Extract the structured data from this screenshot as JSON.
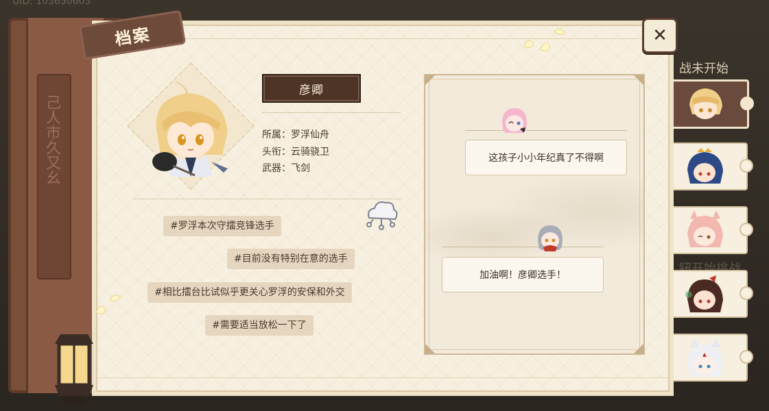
{
  "header": {
    "uid_label": "UID: 103650605"
  },
  "tag": {
    "label": "档案"
  },
  "close": {
    "symbol": "✕"
  },
  "profile": {
    "name": "彦卿",
    "affiliation_label": "所属：",
    "affiliation": "罗浮仙舟",
    "title_label": "头衔：",
    "title": "云骑骁卫",
    "weapon_label": "武器：",
    "weapon": "飞剑"
  },
  "tags": [
    "#罗浮本次守擂竞锋选手",
    "#目前没有特别在意的选手",
    "#相比擂台比试似乎更关心罗浮的安保和外交",
    "#需要适当放松一下了"
  ],
  "comments": [
    {
      "text": "这孩子小小年纪真了不得啊"
    },
    {
      "text": "加油啊！彦卿选手！"
    }
  ],
  "side_status": {
    "top": "战未开始",
    "bottom": "钮开始挑战"
  },
  "spine_glyphs": "己人市久又幺",
  "colors": {
    "panel": "#f7f0e0",
    "accent": "#4e3327",
    "chip": "#e6d6c0"
  }
}
